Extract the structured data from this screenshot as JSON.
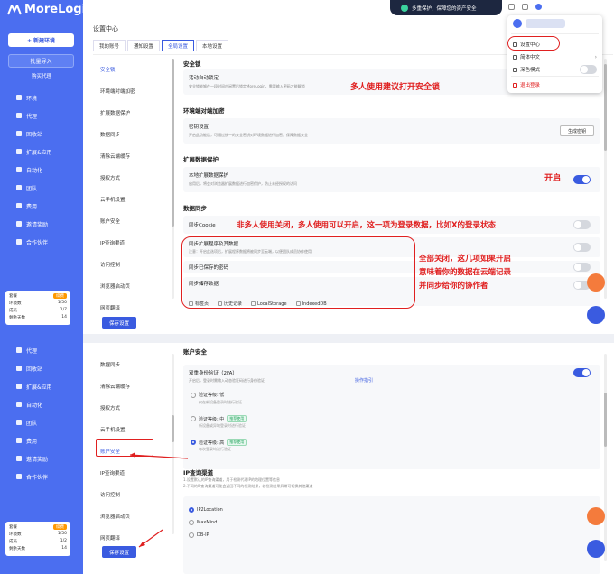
{
  "app": {
    "name": "MoreLogin"
  },
  "promo": {
    "text": "多重保护，保障您的资产安全"
  },
  "sidebar": {
    "new_env_label": "+ 新建环境",
    "batch_import_label": "批量导入",
    "proxy_link_label": "购买代理",
    "items": [
      "环境",
      "代理",
      "回收站",
      "扩展&应用",
      "自动化",
      "团队",
      "费用",
      "邀请奖励",
      "合作伙伴"
    ],
    "items_bottom": [
      "代理",
      "回收站",
      "扩展&应用",
      "自动化",
      "团队",
      "费用",
      "邀请奖励",
      "合作伙伴"
    ],
    "quota": {
      "plan_label": "套餐",
      "plan_badge": "续费",
      "rows": [
        [
          "环境数",
          "1/50"
        ],
        [
          "成员",
          "1/7"
        ],
        [
          "剩余天数",
          "14"
        ]
      ]
    },
    "quota_bottom": {
      "plan_label": "套餐",
      "plan_badge": "续费",
      "rows": [
        [
          "环境数",
          "1/50"
        ],
        [
          "成员",
          "1/2"
        ],
        [
          "剩余天数",
          "14"
        ]
      ]
    }
  },
  "header": {
    "title": "设置中心"
  },
  "tabs": [
    "我的账号",
    "通知设置",
    "全局设置",
    "本地设置"
  ],
  "subnav_top": [
    "安全锁",
    "环境端对端加密",
    "扩展数据保护",
    "数据同步",
    "清除云端缓存",
    "授权方式",
    "云手机设置",
    "账户安全",
    "IP查询渠道",
    "访问控制",
    "浏览器启动页",
    "网页翻译"
  ],
  "subnav_bottom": [
    "数据同步",
    "清除云端缓存",
    "授权方式",
    "云手机设置",
    "账户安全",
    "IP查询渠道",
    "访问控制",
    "浏览器启动页",
    "网页翻译"
  ],
  "sections": {
    "lock": {
      "title": "安全锁",
      "item": "活动自动锁定",
      "desc": "安全锁能够在一段时间内闲置后锁定MoreLogin，需要输入密码才能解锁"
    },
    "e2e": {
      "title": "环境端对端加密",
      "item": "密钥设置",
      "desc": "开启此功能后，可通过统一的安全密钥对环境数据进行加密，保障数据安全",
      "btn": "生成密钥"
    },
    "ext": {
      "title": "扩展数据保护",
      "item": "本地扩展数据保护",
      "desc": "启用后，将会对浏览器扩展数据进行加密保护，防止未经授权的访问"
    },
    "sync": {
      "title": "数据同步",
      "cookie": "同步Cookie",
      "ext_data": "同步扩展程序及其数据",
      "ext_desc": "注意：开启此选项后，扩展程序数据将被同步至云端，以便团队成员协作使用",
      "passwords": "同步已保存的密码",
      "storage": "同步储存数据",
      "checks": [
        "标签页",
        "历史记录",
        "LocalStorage",
        "IndexedDB"
      ]
    },
    "save_label": "保存设置",
    "account": {
      "title": "账户安全",
      "tfa": "双重身份验证（2FA）",
      "tfa_desc": "开启后，登录时需输入动态验证码进行身份验证",
      "tfa_link": "操作指引",
      "levels": [
        {
          "label": "验证等级: 低",
          "desc": "仅在新设备登录时进行验证",
          "tag": ""
        },
        {
          "label": "验证等级: 中",
          "desc": "新设备或异地登录时进行验证",
          "tag": "推荐使用"
        },
        {
          "label": "验证等级: 高",
          "desc": "每次登录均进行验证",
          "tag": "推荐使用"
        }
      ]
    },
    "ip": {
      "title": "IP查询渠道",
      "desc1": "1.设置默认的IP查询渠道，用于检测代理IP的地理位置等信息",
      "desc2": "2.不同的IP查询渠道可能会返回不同的检测结果，若检测结果异常可切换其他渠道",
      "options": [
        "IP2Location",
        "MaxMind",
        "DB-IP"
      ]
    }
  },
  "dropdown": {
    "items": [
      "设置中心",
      "简体中文",
      "深色模式",
      "退出登录"
    ]
  },
  "annotations": {
    "a1": "多人使用建议打开安全锁",
    "a2": "开启",
    "a3": "非多人使用关闭，多人使用可以开启，这一项为登录数据，比如X的登录状态",
    "a4": "全部关闭，这几项如果开启\n意味着你的数据在云端记录\n并同步给你的协作者"
  },
  "colors": {
    "primary": "#3a5be0",
    "sidebar": "#4b6ef0",
    "annotation": "#e02020"
  }
}
